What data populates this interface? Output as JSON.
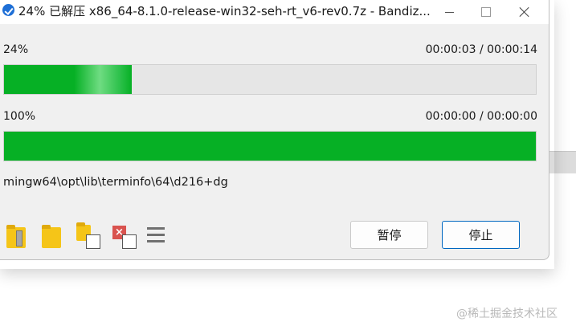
{
  "window": {
    "title": "24% 已解压 x86_64-8.1.0-release-win32-seh-rt_v6-rev0.7z - Bandiz...",
    "app_icon": "bandizip-app-icon"
  },
  "current_file_progress": {
    "percent_label": "24%",
    "percent_value": 24,
    "time_label": "00:00:03 / 00:00:14"
  },
  "total_progress": {
    "percent_label": "100%",
    "percent_value": 100,
    "time_label": "00:00:00 / 00:00:00"
  },
  "current_path": "mingw64\\opt\\lib\\terminfo\\64\\d216+dg",
  "toolbar": {
    "icons": [
      "open-archive-folder-icon",
      "open-folder-icon",
      "copy-to-folder-icon",
      "delete-file-icon",
      "menu-icon"
    ]
  },
  "buttons": {
    "pause": "暂停",
    "stop": "停止"
  },
  "watermark": "@稀土掘金技术社区",
  "colors": {
    "progress_fill": "#06b025",
    "progress_track": "#e6e6e6",
    "accent_border": "#0067c0"
  }
}
